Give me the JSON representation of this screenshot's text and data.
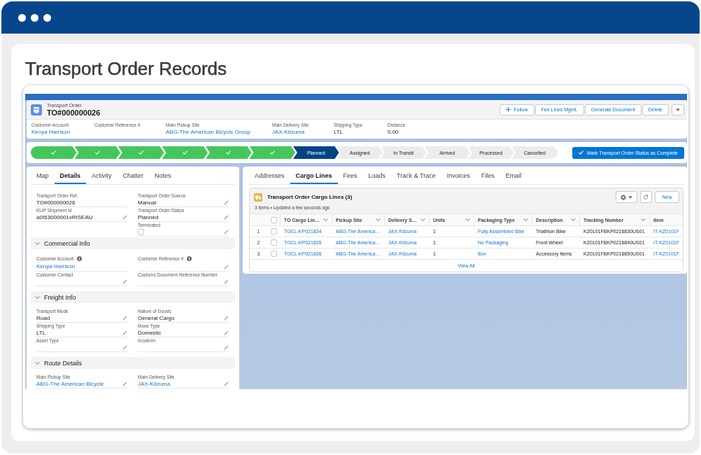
{
  "window": {
    "title": "Transport Order Records"
  },
  "record_header": {
    "object_label": "Transport Order",
    "name": "TO#000000026",
    "actions": [
      {
        "kind": "follow",
        "label": "Follow"
      },
      {
        "kind": "text",
        "label": "Fee Lines Mgmt."
      },
      {
        "kind": "text",
        "label": "Generate Document"
      },
      {
        "kind": "text",
        "label": "Delete"
      },
      {
        "kind": "menu"
      }
    ],
    "highlights": [
      {
        "kind": "link",
        "label": "Customer Account",
        "value": "Kenya Harrison"
      },
      {
        "kind": "text",
        "label": "Customer Reference #"
      },
      {
        "kind": "link",
        "label": "Main Pickup Site",
        "value": "ABG-The American Bicycle Group"
      },
      {
        "kind": "link",
        "label": "Main Delivery Site",
        "value": "JAX-Kitzuma"
      },
      {
        "kind": "text",
        "label": "Shipping Type",
        "value": "LTL"
      },
      {
        "kind": "text",
        "label": "Distance",
        "value": "0.00"
      }
    ]
  },
  "path": {
    "stages": [
      {
        "complete": true,
        "selected": false
      },
      {
        "complete": true,
        "selected": false
      },
      {
        "complete": true,
        "selected": false
      },
      {
        "complete": true,
        "selected": false
      },
      {
        "complete": true,
        "selected": false
      },
      {
        "complete": true,
        "selected": false
      },
      {
        "label": "Planned",
        "complete": false,
        "selected": true
      },
      {
        "label": "Assigned",
        "complete": false,
        "selected": false
      },
      {
        "label": "In Transit",
        "complete": false,
        "selected": false
      },
      {
        "label": "Arrived",
        "complete": false,
        "selected": false
      },
      {
        "label": "Processed",
        "complete": false,
        "selected": false
      },
      {
        "label": "Cancelled",
        "complete": false,
        "selected": false
      }
    ],
    "complete_button": "Mark Transport Order Status as Complete"
  },
  "details_panel": {
    "tabs": [
      {
        "label": "Map",
        "selected": false
      },
      {
        "label": "Details",
        "selected": true
      },
      {
        "label": "Activity",
        "selected": false
      },
      {
        "label": "Chatter",
        "selected": false
      },
      {
        "label": "Notes",
        "selected": false
      }
    ],
    "columns": [
      [
        {
          "kind": "text",
          "label": "Transport Order Ref.",
          "value": "TO#000000026",
          "editable": false,
          "info": false
        },
        {
          "kind": "text",
          "label": "KLIP Shipment Id",
          "value": "a0I53000001xRISEAU",
          "editable": true,
          "info": false
        }
      ],
      [
        {
          "kind": "text",
          "label": "Transport Order Source",
          "value": "Manual",
          "editable": true,
          "info": false
        },
        {
          "kind": "text",
          "label": "Transport Order Status",
          "value": "Planned",
          "editable": true,
          "info": false
        },
        {
          "kind": "checkbox",
          "label": "Terminated",
          "checked": false,
          "editable": true,
          "info": false
        }
      ]
    ],
    "sections": [
      {
        "title": "Commercial Info",
        "expanded": true,
        "columns": [
          [
            {
              "kind": "link",
              "label": "Customer Account",
              "value": "Kenya Harrison",
              "editable": false,
              "info": true
            },
            {
              "kind": "text",
              "label": "Customer Contact",
              "editable": true,
              "info": false
            }
          ],
          [
            {
              "kind": "text",
              "label": "Customer Reference #",
              "editable": true,
              "info": true
            },
            {
              "kind": "text",
              "label": "Customs Document Reference Number",
              "editable": true,
              "info": false
            }
          ]
        ]
      },
      {
        "title": "Freight Info",
        "expanded": true,
        "columns": [
          [
            {
              "kind": "text",
              "label": "Transport Mode",
              "value": "Road",
              "editable": true,
              "info": false
            },
            {
              "kind": "text",
              "label": "Shipping Type",
              "value": "LTL",
              "editable": true,
              "info": false
            },
            {
              "kind": "text",
              "label": "Asset Type",
              "editable": true,
              "info": false
            }
          ],
          [
            {
              "kind": "text",
              "label": "Nature of Goods",
              "value": "General Cargo",
              "editable": true,
              "info": false
            },
            {
              "kind": "text",
              "label": "Move Type",
              "value": "Domestic",
              "editable": true,
              "info": false
            },
            {
              "kind": "text",
              "label": "Incoterm",
              "editable": true,
              "info": false
            }
          ]
        ]
      },
      {
        "title": "Route Details",
        "expanded": true,
        "columns": [
          [
            {
              "kind": "link",
              "label": "Main Pickup Site",
              "value": "ABG-The American Bicycle",
              "editable": true,
              "info": false
            }
          ],
          [
            {
              "kind": "link",
              "label": "Main Delivery Site",
              "value": "JAX-Kitzuma",
              "editable": true,
              "info": false
            }
          ]
        ]
      }
    ]
  },
  "related_panel": {
    "tabs": [
      {
        "label": "Addresses",
        "selected": false
      },
      {
        "label": "Cargo Lines",
        "selected": true
      },
      {
        "label": "Fees",
        "selected": false
      },
      {
        "label": "Loads",
        "selected": false
      },
      {
        "label": "Track & Trace",
        "selected": false
      },
      {
        "label": "Invoices",
        "selected": false
      },
      {
        "label": "Files",
        "selected": false
      },
      {
        "label": "Email",
        "selected": false
      }
    ],
    "list": {
      "title": "Transport Order Cargo Lines (3)",
      "subtitle": "3 items • Updated a few seconds ago",
      "new_button": "New",
      "select_all_checked": false,
      "columns": [
        {
          "label": "TO Cargo Lin…",
          "menu": true
        },
        {
          "label": "Pickup Site",
          "menu": true
        },
        {
          "label": "Delivery S…",
          "menu": true
        },
        {
          "label": "Units",
          "menu": true
        },
        {
          "label": "Packaging Type",
          "menu": true
        },
        {
          "label": "Description",
          "menu": true
        },
        {
          "label": "Tracking Number",
          "menu": true
        },
        {
          "label": "Item",
          "menu": false
        }
      ],
      "rows": [
        {
          "number": "1",
          "selected": false,
          "cells": [
            {
              "kind": "link",
              "text": "TOCL-KP021834"
            },
            {
              "kind": "link",
              "text": "ABG-The America…"
            },
            {
              "kind": "link",
              "text": "JAX-Kitzuma"
            },
            {
              "kind": "text",
              "text": "1"
            },
            {
              "kind": "link",
              "text": "Fully Assembled Bike"
            },
            {
              "kind": "text",
              "text": "Triathlon Bike"
            },
            {
              "kind": "text",
              "text": "KZ0101FBKP0216830US01"
            },
            {
              "kind": "link",
              "text": "IT-KZ0101F"
            }
          ]
        },
        {
          "number": "2",
          "selected": false,
          "cells": [
            {
              "kind": "link",
              "text": "TOCL-KP021835"
            },
            {
              "kind": "link",
              "text": "ABG-The America…"
            },
            {
              "kind": "link",
              "text": "JAX-Kitzuma"
            },
            {
              "kind": "text",
              "text": "1"
            },
            {
              "kind": "link",
              "text": "No Packaging"
            },
            {
              "kind": "text",
              "text": "Front Wheel"
            },
            {
              "kind": "text",
              "text": "KZ0101FBKP0216840US01"
            },
            {
              "kind": "link",
              "text": "IT-KZ0101F"
            }
          ]
        },
        {
          "number": "3",
          "selected": false,
          "cells": [
            {
              "kind": "link",
              "text": "TOCL-KP021836"
            },
            {
              "kind": "link",
              "text": "ABG-The America…"
            },
            {
              "kind": "link",
              "text": "JAX-Kitzuma"
            },
            {
              "kind": "text",
              "text": "1"
            },
            {
              "kind": "link",
              "text": "Box"
            },
            {
              "kind": "text",
              "text": "Accessory Items"
            },
            {
              "kind": "text",
              "text": "KZ0101FBKP0216850US01"
            },
            {
              "kind": "link",
              "text": "IT-KZ0101F"
            }
          ]
        }
      ],
      "view_all": "View All"
    }
  }
}
